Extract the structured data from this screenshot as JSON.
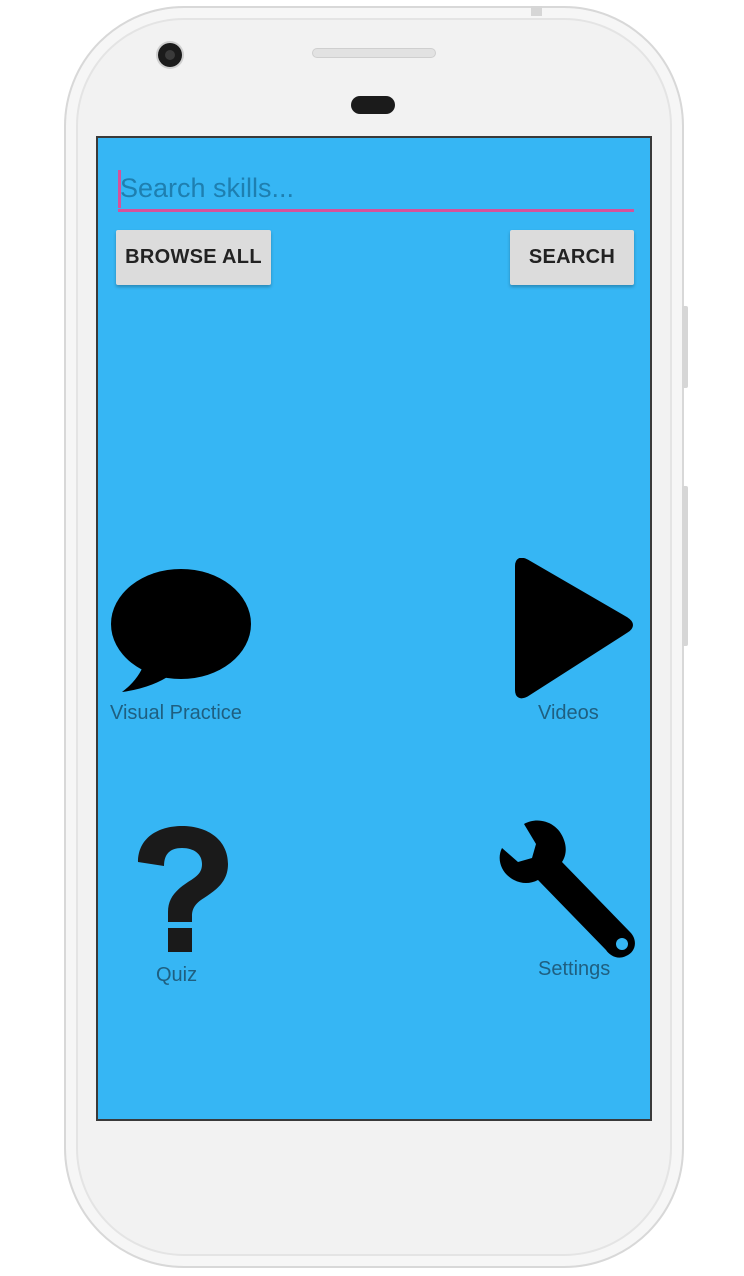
{
  "search": {
    "placeholder": "Search skills...",
    "value": ""
  },
  "buttons": {
    "browse_all": "BROWSE ALL",
    "search": "SEARCH"
  },
  "tiles": [
    {
      "label": "Visual Practice",
      "icon": "speech-bubble-icon"
    },
    {
      "label": "Videos",
      "icon": "play-icon"
    },
    {
      "label": "Quiz",
      "icon": "question-mark-icon"
    },
    {
      "label": "Settings",
      "icon": "wrench-icon"
    }
  ],
  "colors": {
    "screen_background": "#36b6f4",
    "accent": "#d6519a",
    "button_background": "#dcdcdc",
    "label_text": "#1f5f80"
  }
}
